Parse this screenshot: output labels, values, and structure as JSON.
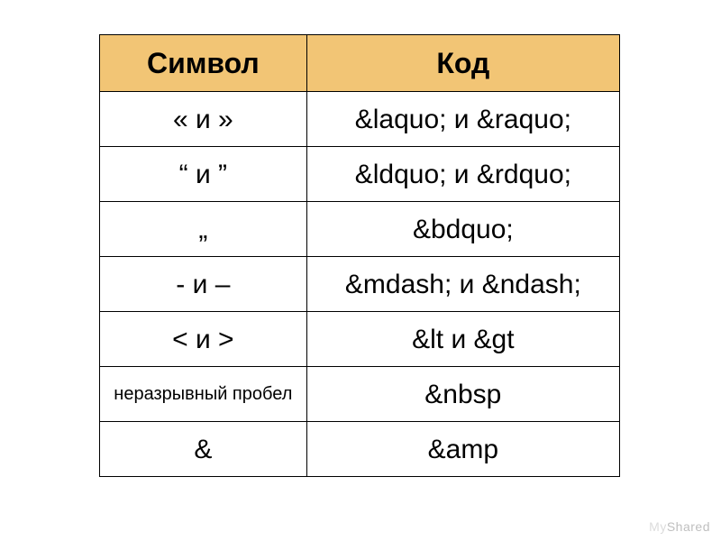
{
  "table": {
    "header": {
      "symbol": "Символ",
      "code": "Код"
    },
    "rows": [
      {
        "symbol_html": "« и »",
        "code_html": "&amp;laquo; и &amp;raquo;"
      },
      {
        "symbol_html": "“ и ”",
        "code_html": "&amp;ldquo; и &amp;rdquo;"
      },
      {
        "symbol_html": "„",
        "code_html": "&amp;bdquo;"
      },
      {
        "symbol_html": "- и –",
        "code_html": "&amp;mdash; и &amp;ndash;"
      },
      {
        "symbol_html": "&lt; и &gt;",
        "code_html": "&amp;lt и &amp;gt"
      },
      {
        "symbol_html": "неразрывный пробел",
        "code_html": "&amp;nbsp",
        "symbol_small": true
      },
      {
        "symbol_html": "&amp;",
        "code_html": "&amp;amp"
      }
    ]
  },
  "watermark": {
    "prefix": "My",
    "suffix": "Shared"
  }
}
